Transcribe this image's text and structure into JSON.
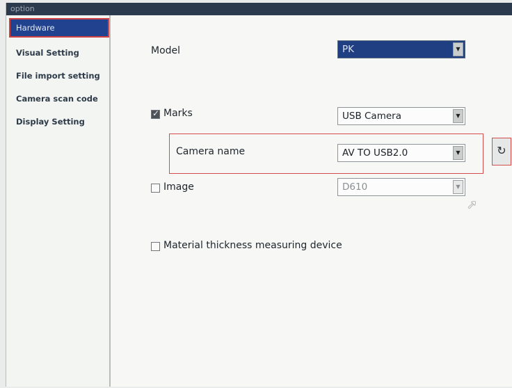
{
  "window": {
    "title": "option"
  },
  "sidebar": {
    "items": [
      {
        "label": "Hardware",
        "active": true
      },
      {
        "label": "Visual Setting"
      },
      {
        "label": "File import setting"
      },
      {
        "label": "Camera scan code"
      },
      {
        "label": "Display Setting"
      }
    ]
  },
  "hardware": {
    "model": {
      "label": "Model",
      "value": "PK"
    },
    "marks": {
      "label": "Marks",
      "checked": true,
      "value": "USB Camera"
    },
    "camera_name": {
      "label": "Camera name",
      "value": "AV TO USB2.0"
    },
    "image": {
      "label": "Image",
      "checked": false,
      "value": "D610"
    },
    "thickness": {
      "label": "Material thickness measuring device",
      "checked": false
    }
  },
  "icons": {
    "dropdown": "chevron-down-icon",
    "refresh": "refresh-icon",
    "cursor": "mouse-pointer-icon"
  },
  "colors": {
    "selection": "#21438f",
    "highlight": "#d34b4b",
    "titlebar": "#2c3a4d"
  }
}
